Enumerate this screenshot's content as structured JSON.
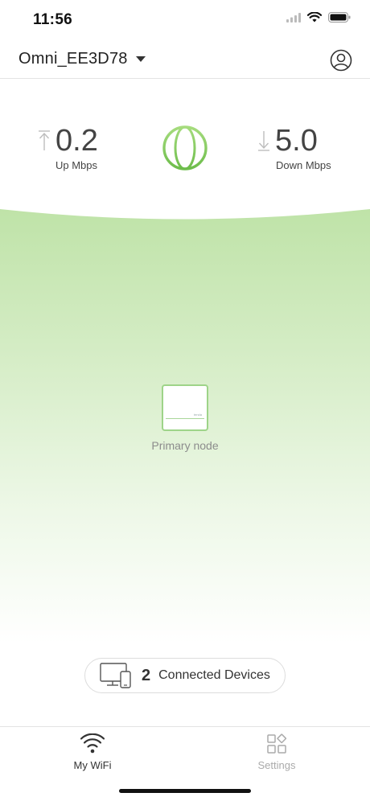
{
  "status_bar": {
    "time": "11:56",
    "icons": [
      "signal-icon",
      "wifi-icon",
      "battery-icon"
    ]
  },
  "header": {
    "network_name": "Omni_EE3D78",
    "dropdown_icon": "caret-down-icon",
    "account_icon": "user-circle-icon"
  },
  "speed": {
    "up": {
      "value": "0.2",
      "unit": "Up Mbps",
      "icon": "arrow-up-icon"
    },
    "down": {
      "value": "5.0",
      "unit": "Down Mbps",
      "icon": "arrow-down-icon"
    },
    "internet_icon": "globe-icon"
  },
  "topology": {
    "node_label": "Primary node",
    "node_brand": "tenda"
  },
  "devices": {
    "count": "2",
    "label": "Connected Devices",
    "icon": "devices-icon"
  },
  "tabs": [
    {
      "label": "My WiFi",
      "icon": "wifi-icon",
      "active": true
    },
    {
      "label": "Settings",
      "icon": "grid-icon",
      "active": false
    }
  ],
  "colors": {
    "accent_green": "#8fcf6a",
    "gradient_green": "#c7e6b6",
    "active_tab": "#333333",
    "inactive_tab": "#aaaaaa"
  }
}
